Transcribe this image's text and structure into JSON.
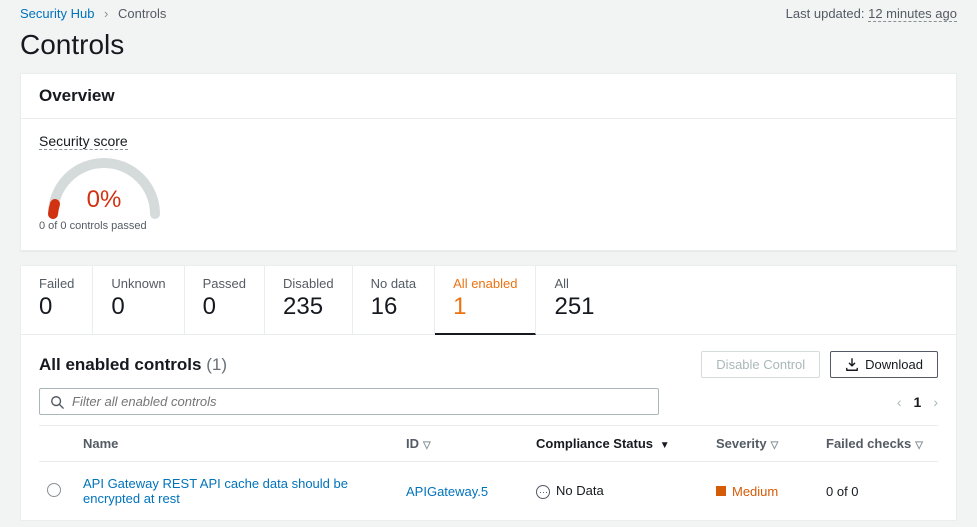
{
  "breadcrumb": {
    "root": "Security Hub",
    "current": "Controls"
  },
  "status": {
    "label": "Last updated:",
    "value": "12 minutes ago"
  },
  "page": {
    "title": "Controls"
  },
  "overview": {
    "heading": "Overview",
    "score_label": "Security score",
    "score_value": "0%",
    "score_sub": "0 of 0 controls passed"
  },
  "tabs": {
    "failed": {
      "label": "Failed",
      "value": "0"
    },
    "unknown": {
      "label": "Unknown",
      "value": "0"
    },
    "passed": {
      "label": "Passed",
      "value": "0"
    },
    "disabled": {
      "label": "Disabled",
      "value": "235"
    },
    "nodata": {
      "label": "No data",
      "value": "16"
    },
    "allenabled": {
      "label": "All enabled",
      "value": "1"
    },
    "all": {
      "label": "All",
      "value": "251"
    }
  },
  "list": {
    "title": "All enabled controls",
    "count": "(1)",
    "disable_btn": "Disable Control",
    "download_btn": "Download",
    "filter_placeholder": "Filter all enabled controls",
    "page_num": "1"
  },
  "table": {
    "headers": {
      "name": "Name",
      "id": "ID",
      "compliance": "Compliance Status",
      "severity": "Severity",
      "failed": "Failed checks"
    },
    "rows": [
      {
        "name": "API Gateway REST API cache data should be encrypted at rest",
        "id": "APIGateway.5",
        "compliance": "No Data",
        "severity": "Medium",
        "failed": "0 of 0"
      }
    ]
  }
}
